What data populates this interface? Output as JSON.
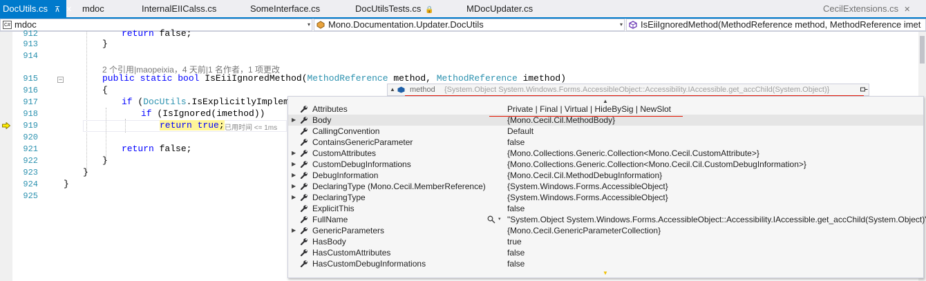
{
  "tabs": [
    {
      "label": "DocUtils.cs",
      "pin": "⊼",
      "close": "✕",
      "active": true
    },
    {
      "label": "mdoc"
    },
    {
      "label": "InternalEIICalss.cs"
    },
    {
      "label": "SomeInterface.cs"
    },
    {
      "label": "DocUtilsTests.cs",
      "lock": "🔒"
    },
    {
      "label": "MDocUpdater.cs"
    },
    {
      "label": "CecilExtensions.cs",
      "close": "✕",
      "preview": true
    }
  ],
  "nav": {
    "project": "mdoc",
    "project_icon": "C#",
    "type": "Mono.Documentation.Updater.DocUtils",
    "member": "IsEiiIgnoredMethod(MethodReference method, MethodReference imet",
    "dropdown": "▾"
  },
  "editor": {
    "line_numbers": [
      "912",
      "913",
      "914",
      "915",
      "916",
      "917",
      "918",
      "919",
      "920",
      "921",
      "922",
      "923",
      "924",
      "925"
    ],
    "lines": {
      "l912_kw": "return",
      "l912_rest": " false;",
      "l913": "}",
      "l915_public": "public",
      "l915_static": "static",
      "l915_bool": "bool",
      "l915_name": " IsEiiIgnoredMethod(",
      "l915_type1": "MethodReference",
      "l915_mid": " method, ",
      "l915_type2": "MethodReference",
      "l915_end": " imethod)",
      "l916": "{",
      "l917_if": "if",
      "l917_open": " (",
      "l917_type": "DocUtils",
      "l917_rest": ".IsExplicitlyImplemente",
      "l918_if": "if",
      "l918_rest": " (IsIgnored(imethod))",
      "l919_return": "return",
      "l919_true": "true",
      "l919_semi": ";",
      "l921_return": "return",
      "l921_rest": " false;",
      "l922": "}",
      "l923": "}",
      "l924": "}"
    },
    "codelens": "2 个引用|maopeixia，4 天前|1 名作者，1 项更改",
    "elapsed": "已用时间 <= 1ms",
    "collapse_glyph": "−"
  },
  "datatip": {
    "expander": "▲",
    "name": "method",
    "value": "{System.Object System.Windows.Forms.AccessibleObject::Accessibility.IAccessible.get_accChild(System.Object)}",
    "scroll_up": "▲",
    "scroll_down": "▼",
    "rows": [
      {
        "name": "Attributes",
        "value": "Private | Final | Virtual | HideBySig | NewSlot",
        "expandable": false
      },
      {
        "name": "Body",
        "value": "{Mono.Cecil.Cil.MethodBody}",
        "expandable": true
      },
      {
        "name": "CallingConvention",
        "value": "Default",
        "expandable": false
      },
      {
        "name": "ContainsGenericParameter",
        "value": "false",
        "expandable": false
      },
      {
        "name": "CustomAttributes",
        "value": "{Mono.Collections.Generic.Collection<Mono.Cecil.CustomAttribute>}",
        "expandable": true
      },
      {
        "name": "CustomDebugInformations",
        "value": "{Mono.Collections.Generic.Collection<Mono.Cecil.Cil.CustomDebugInformation>}",
        "expandable": true
      },
      {
        "name": "DebugInformation",
        "value": "{Mono.Cecil.Cil.MethodDebugInformation}",
        "expandable": true
      },
      {
        "name": "DeclaringType (Mono.Cecil.MemberReference)",
        "value": "{System.Windows.Forms.AccessibleObject}",
        "expandable": true
      },
      {
        "name": "DeclaringType",
        "value": "{System.Windows.Forms.AccessibleObject}",
        "expandable": true
      },
      {
        "name": "ExplicitThis",
        "value": "false",
        "expandable": false
      },
      {
        "name": "FullName",
        "value": "\"System.Object System.Windows.Forms.AccessibleObject::Accessibility.IAccessible.get_accChild(System.Object)\"",
        "expandable": false,
        "visualizer": true
      },
      {
        "name": "GenericParameters",
        "value": "{Mono.Cecil.GenericParameterCollection}",
        "expandable": true
      },
      {
        "name": "HasBody",
        "value": "true",
        "expandable": false
      },
      {
        "name": "HasCustomAttributes",
        "value": "false",
        "expandable": false
      },
      {
        "name": "HasCustomDebugInformations",
        "value": "false",
        "expandable": false
      }
    ],
    "row_expander": "▶",
    "visualizer_dropdown": "▾"
  },
  "colors": {
    "accent": "#007acc",
    "keyword": "#0000ff",
    "type": "#2b91af",
    "error_underline": "#e51400",
    "current_statement": "#fff599"
  }
}
